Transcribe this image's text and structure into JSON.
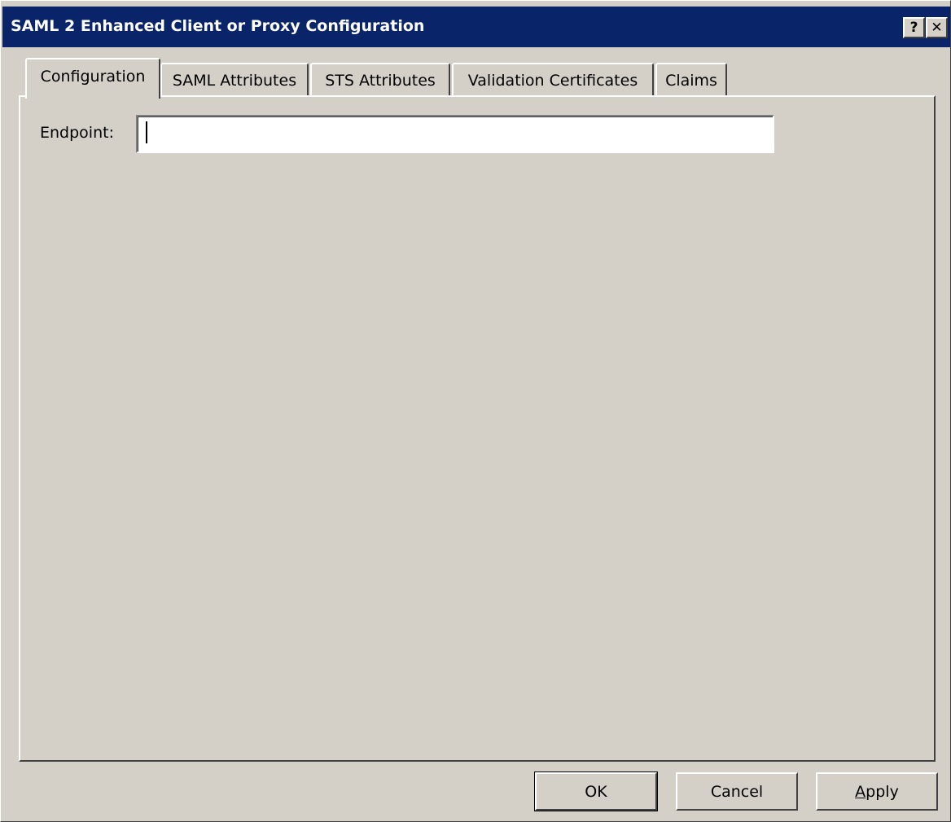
{
  "window": {
    "title": "SAML 2 Enhanced Client or Proxy Configuration",
    "help_glyph": "?",
    "close_glyph": "✕"
  },
  "tabs": [
    {
      "label": "Configuration",
      "active": true
    },
    {
      "label": "SAML Attributes",
      "active": false
    },
    {
      "label": "STS Attributes",
      "active": false
    },
    {
      "label": "Validation Certificates",
      "active": false
    },
    {
      "label": "Claims",
      "active": false
    }
  ],
  "config": {
    "endpoint_label": "Endpoint:",
    "endpoint_value": ""
  },
  "buttons": {
    "ok": "OK",
    "cancel": "Cancel",
    "apply_first": "A",
    "apply_rest": "pply"
  },
  "colors": {
    "titlebar": "#0a246a",
    "face": "#d4d0c8"
  }
}
